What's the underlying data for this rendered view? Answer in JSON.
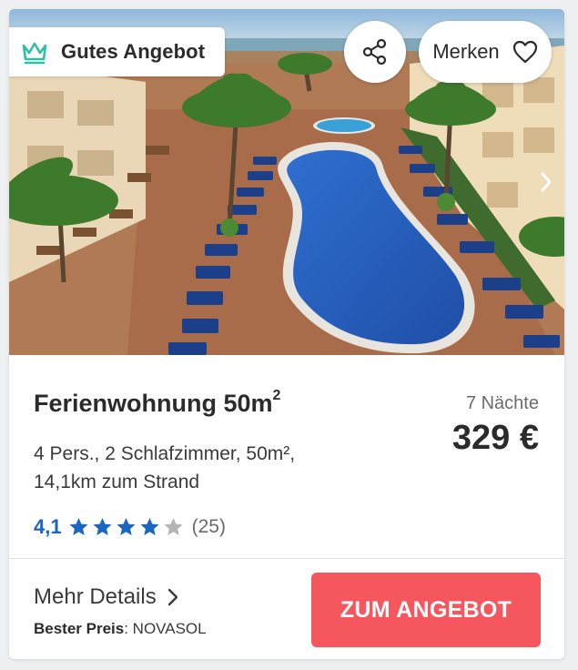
{
  "card": {
    "badge": {
      "label": "Gutes Angebot",
      "icon": "crown-icon",
      "icon_color": "#2bbfa4"
    },
    "actions": {
      "share_icon": "share-icon",
      "save_label": "Merken",
      "save_icon": "heart-outline-icon"
    },
    "gallery": {
      "next_icon": "chevron-right-icon"
    },
    "listing": {
      "title": "Ferienwohnung 50m",
      "title_sup": "2",
      "description_line1": "4 Pers., 2 Schlafzimmer, 50m²,",
      "description_line2": "14,1km zum Strand",
      "rating_score": "4,1",
      "rating_stars": 4,
      "rating_max": 5,
      "rating_count": "(25)",
      "rating_color": "#1a66c2"
    },
    "pricing": {
      "nights": "7 Nächte",
      "price": "329 €"
    },
    "footer": {
      "details_label": "Mehr Details",
      "best_price_label": "Bester Preis",
      "best_price_provider": ": NOVASOL",
      "cta_label": "ZUM ANGEBOT",
      "cta_color": "#f6575f"
    }
  }
}
